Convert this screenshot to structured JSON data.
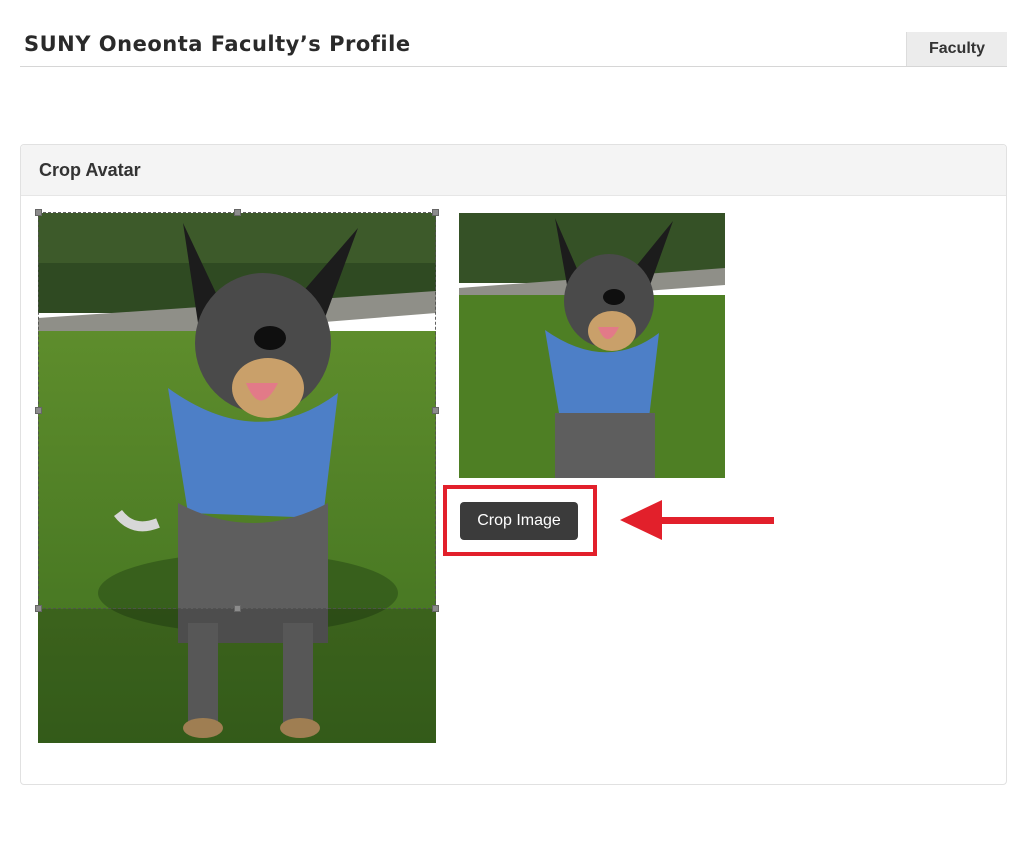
{
  "header": {
    "title": "SUNY Oneonta Faculty’s Profile",
    "role_tab": "Faculty"
  },
  "panel": {
    "title": "Crop Avatar",
    "crop_button_label": "Crop Image"
  },
  "colors": {
    "highlight": "#e2202b",
    "button_bg": "#3b3b3b",
    "panel_header_bg": "#f4f4f4"
  }
}
